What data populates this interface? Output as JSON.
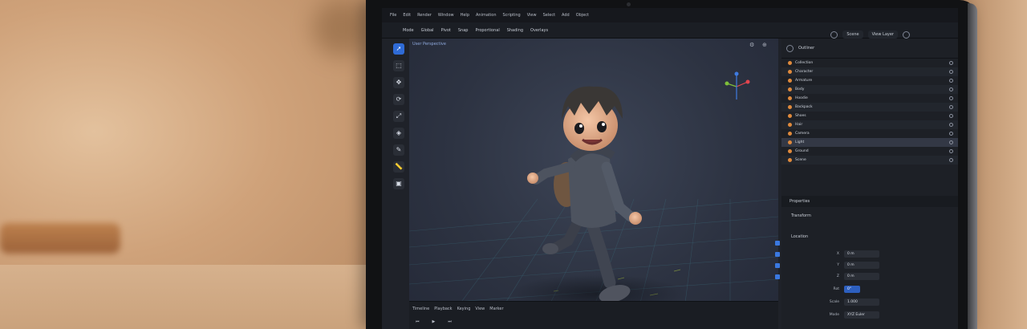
{
  "scene": {
    "description_colors": {
      "wall": "#d4ab85",
      "bezel": "#111214",
      "accent": "#2f6bd6",
      "outliner_dot": "#e08a3c"
    }
  },
  "app": {
    "menu": [
      "File",
      "Edit",
      "Render",
      "Window",
      "Help",
      "Animation",
      "Scripting",
      "View",
      "Select",
      "Add",
      "Object"
    ],
    "toolbar": [
      "Mode",
      "Global",
      "Pivot",
      "Snap",
      "Proportional",
      "Shading",
      "Overlays"
    ],
    "header_fields": [
      "Scene",
      "View Layer"
    ],
    "viewport_tab": "User Perspective",
    "tools": [
      "cursor-icon",
      "select-icon",
      "move-icon",
      "rotate-icon",
      "scale-icon",
      "transform-icon",
      "annotate-icon",
      "measure-icon",
      "add-cube-icon"
    ],
    "bottom_tabs": [
      "Timeline",
      "Playback",
      "Keying",
      "View",
      "Marker"
    ],
    "outliner": {
      "title": "Outliner",
      "items": [
        "Collection",
        "Character",
        "Armature",
        "Body",
        "Hoodie",
        "Backpack",
        "Shoes",
        "Hair",
        "Camera",
        "Light",
        "Ground",
        "Scene"
      ]
    },
    "properties": {
      "title": "Properties",
      "section1": "Transform",
      "section2": "Location",
      "rows": [
        {
          "k": "X",
          "v": "0 m"
        },
        {
          "k": "Y",
          "v": "0 m"
        },
        {
          "k": "Z",
          "v": "0 m"
        },
        {
          "k": "Rot",
          "v": "0°"
        },
        {
          "k": "Scale",
          "v": "1.000"
        },
        {
          "k": "Mode",
          "v": "XYZ Euler"
        }
      ]
    }
  }
}
